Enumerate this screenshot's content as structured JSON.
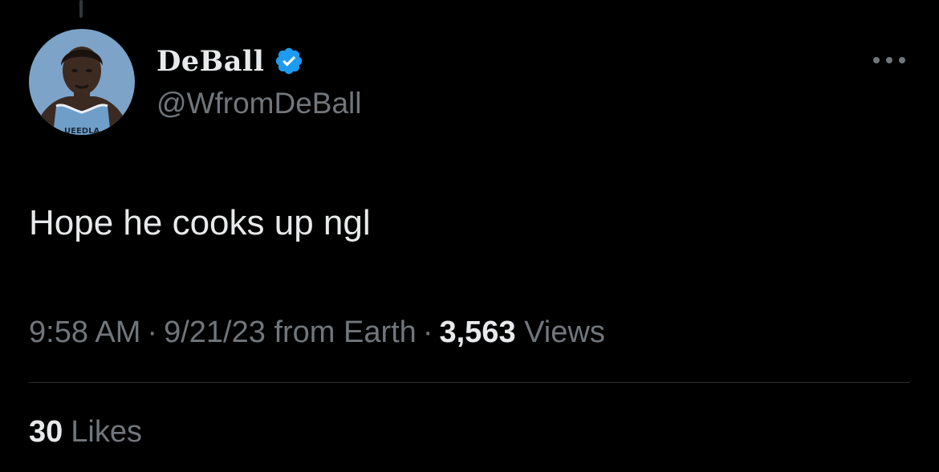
{
  "author": {
    "display_name": "DeBall",
    "handle": "@WfromDeBall",
    "verified_icon": "verified-badge-icon",
    "avatar_icon": "profile-avatar"
  },
  "tweet": {
    "text": "Hope he cooks up ngl",
    "time": "9:58 AM",
    "date": "9/21/23",
    "source": "from Earth",
    "views_count": "3,563",
    "views_label": "Views",
    "separator": "·"
  },
  "engagement": {
    "likes_count": "30",
    "likes_label": "Likes"
  },
  "menu": {
    "icon": "more-options-icon"
  },
  "colors": {
    "background": "#000000",
    "primary_text": "#e7e9ea",
    "secondary_text": "#71767b",
    "verified_blue": "#1d9bf0",
    "divider": "#2f3336"
  }
}
